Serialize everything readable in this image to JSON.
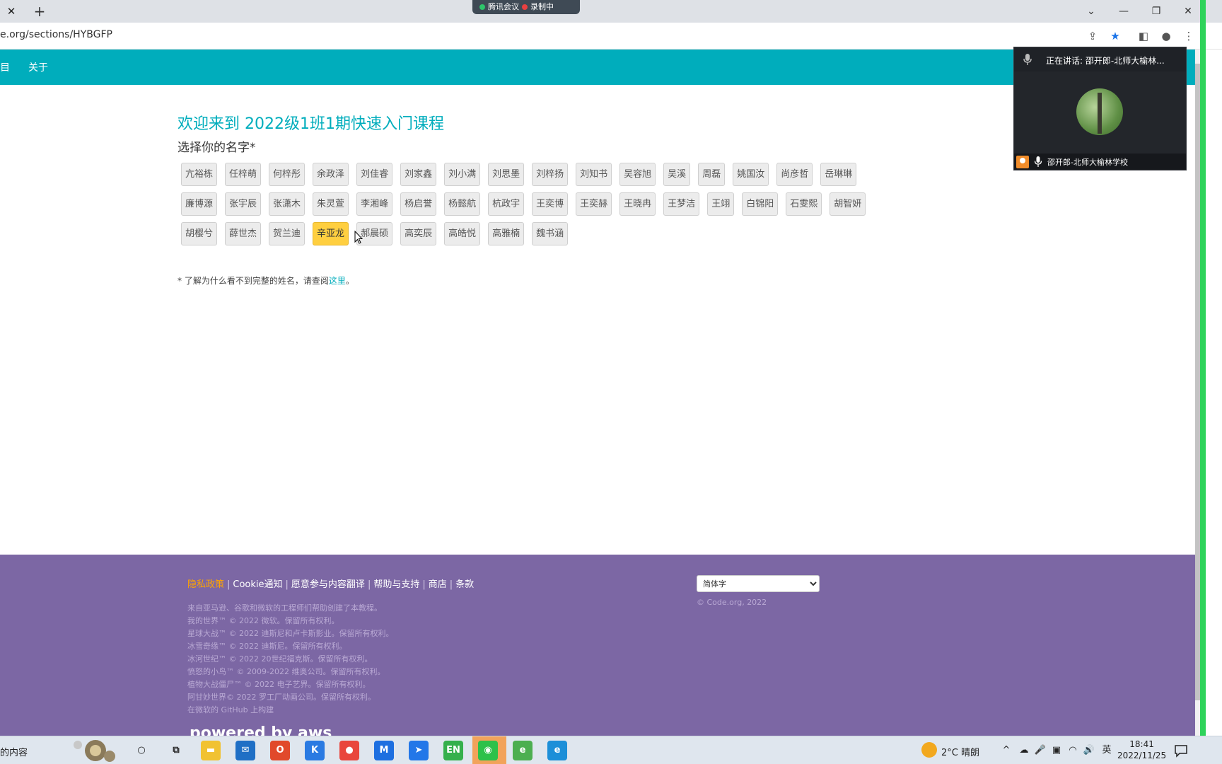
{
  "browser": {
    "close_tab_glyph": "✕",
    "new_tab_glyph": "+",
    "url": "e.org/sections/HYBGFP",
    "meeting_label": "腾讯会议",
    "recording_label": "录制中",
    "window_controls": {
      "dropdown": "⌄",
      "minimize": "—",
      "restore": "❐",
      "close": "✕"
    }
  },
  "nav": {
    "partial_item": "目",
    "about": "关于"
  },
  "main": {
    "welcome": "欢迎来到 2022级1班1期快速入门课程",
    "choose_name": "选择你的名字*",
    "name_rows": [
      [
        "亢裕栋",
        "任梓萌",
        "何梓彤",
        "余政泽",
        "刘佳睿",
        "刘家鑫",
        "刘小满",
        "刘思墨",
        "刘梓扬",
        "刘知书",
        "吴容旭",
        "吴溪",
        "周磊",
        "姚国汝",
        "尚彦哲",
        "岳琳琳"
      ],
      [
        "廉博源",
        "张宇辰",
        "张潇木",
        "朱灵萱",
        "李湘峰",
        "杨启誉",
        "杨懿航",
        "杭政宇",
        "王奕博",
        "王奕赫",
        "王晓冉",
        "王梦洁",
        "王翊",
        "白锦阳",
        "石雯熙",
        "胡智妍"
      ],
      [
        "胡樱兮",
        "薛世杰",
        "贺兰迪",
        "辛亚龙",
        "郝晨硕",
        "高奕辰",
        "高皓悦",
        "高雅楠",
        "魏书涵"
      ]
    ],
    "active_name": "辛亚龙",
    "note_prefix": "* 了解为什么看不到完整的姓名，请查阅",
    "note_link": "这里",
    "note_suffix": "。"
  },
  "video": {
    "speaking": "正在讲话: 邵开郎-北师大榆林...",
    "participant": "邵开郎-北师大榆林学校"
  },
  "footer": {
    "links": [
      "隐私政策",
      "Cookie通知",
      "愿意参与内容翻译",
      "帮助与支持",
      "商店",
      "条款"
    ],
    "separator": "|",
    "credits": [
      "来自亚马逊、谷歌和微软的工程师们帮助创建了本教程。",
      "我的世界™ © 2022 微软。保留所有权利。",
      "星球大战™ © 2022 迪斯尼和卢卡斯影业。保留所有权利。",
      "冰雪奇缘™ © 2022 迪斯尼。保留所有权利。",
      "冰河世纪™ © 2022 20世纪福克斯。保留所有权利。",
      "愤怒的小鸟™ © 2009-2022 维奥公司。保留所有权利。",
      "植物大战僵尸™ © 2022 电子艺界。保留所有权利。",
      "阿甘妙世界© 2022 罗工厂动画公司。保留所有权利。",
      "在微软的 GitHub 上构建"
    ],
    "powered_by": "powered by aws",
    "language": "简体字",
    "copyright": "© Code.org, 2022"
  },
  "taskbar": {
    "search_text": "的内容",
    "apps": [
      {
        "name": "cortana",
        "glyph": "○",
        "color": "#dfe6ee"
      },
      {
        "name": "task-view",
        "glyph": "⧉",
        "color": "#dfe6ee"
      },
      {
        "name": "file-explorer",
        "glyph": "▬",
        "color": "#f1c232"
      },
      {
        "name": "mail",
        "glyph": "✉",
        "color": "#1f6fc5"
      },
      {
        "name": "office",
        "glyph": "O",
        "color": "#e1492b"
      },
      {
        "name": "k-app",
        "glyph": "K",
        "color": "#2a7ae2"
      },
      {
        "name": "chrome",
        "glyph": "●",
        "color": "#e9463c"
      },
      {
        "name": "tencent-meeting",
        "glyph": "M",
        "color": "#1d6fe0"
      },
      {
        "name": "feishu",
        "glyph": "➤",
        "color": "#2377e8"
      },
      {
        "name": "en-app",
        "glyph": "EN",
        "color": "#35b04c"
      },
      {
        "name": "wechat",
        "glyph": "◉",
        "color": "#2dc14a"
      },
      {
        "name": "e-app",
        "glyph": "e",
        "color": "#4caf50"
      },
      {
        "name": "edge",
        "glyph": "e",
        "color": "#1c8fd8"
      }
    ],
    "weather": "2°C  晴朗",
    "tray": [
      "^",
      "☁",
      "🎤",
      "▣",
      "◠",
      "🔊",
      "英"
    ],
    "time": "18:41",
    "date": "2022/11/25"
  }
}
